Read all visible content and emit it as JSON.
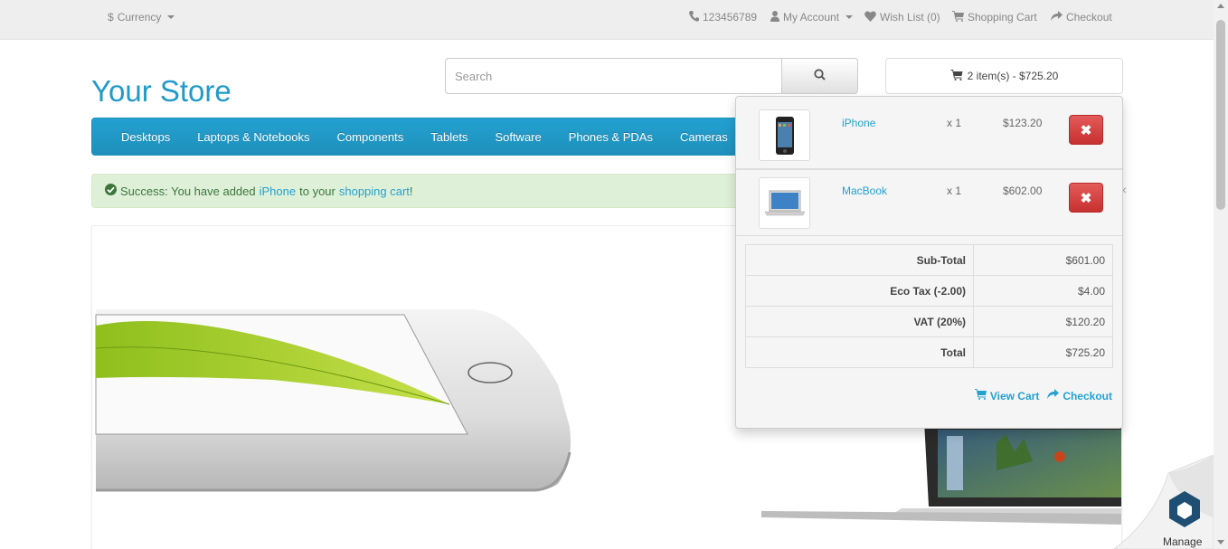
{
  "top_bar": {
    "currency_symbol": "$",
    "currency_label": "Currency",
    "phone": "123456789",
    "my_account": "My Account",
    "wish_list": "Wish List (0)",
    "shopping_cart": "Shopping Cart",
    "checkout": "Checkout"
  },
  "header": {
    "logo": "Your Store",
    "search_placeholder": "Search",
    "search_value": "",
    "cart_button": "2 item(s) - $725.20"
  },
  "menu": {
    "items": [
      "Desktops",
      "Laptops & Notebooks",
      "Components",
      "Tablets",
      "Software",
      "Phones & PDAs",
      "Cameras"
    ]
  },
  "alert": {
    "prefix": "Success: You have added",
    "product_link": "iPhone",
    "middle": "to your",
    "cart_link": "shopping cart",
    "suffix": "!",
    "close": "×"
  },
  "cart_dropdown": {
    "items": [
      {
        "name": "iPhone",
        "qty": "x 1",
        "price": "$123.20",
        "remove": "✖"
      },
      {
        "name": "MacBook",
        "qty": "x 1",
        "price": "$602.00",
        "remove": "✖"
      }
    ],
    "totals": [
      {
        "label": "Sub-Total",
        "value": "$601.00"
      },
      {
        "label": "Eco Tax (-2.00)",
        "value": "$4.00"
      },
      {
        "label": "VAT (20%)",
        "value": "$120.20"
      },
      {
        "label": "Total",
        "value": "$725.20"
      }
    ],
    "view_cart": "View Cart",
    "checkout": "Checkout"
  },
  "manage_widget": {
    "label": "Manage"
  },
  "colors": {
    "accent": "#23a1d1",
    "logo": "#229ac8",
    "alert_bg": "#dff0d8",
    "alert_text": "#3c763d",
    "remove_button": "#d9534f"
  }
}
